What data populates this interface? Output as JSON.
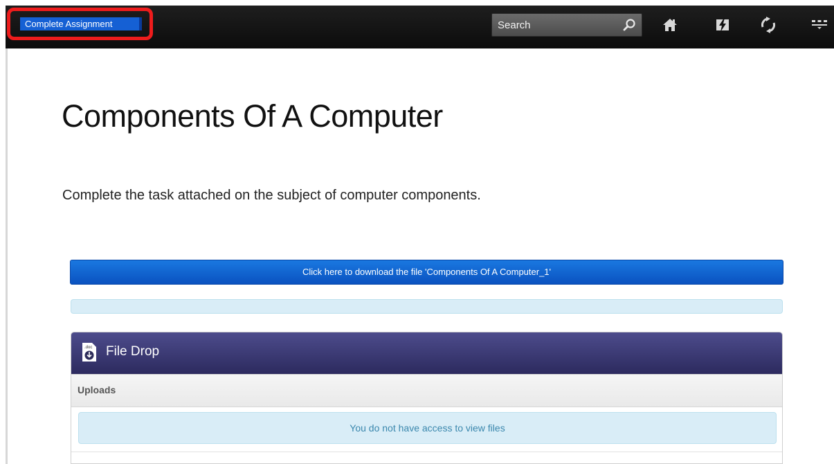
{
  "topbar": {
    "complete_label": "Complete Assignment",
    "search_placeholder": "Search",
    "icons": [
      "search-icon",
      "home-icon",
      "flash-icon",
      "sync-icon",
      "menu-icon"
    ]
  },
  "page": {
    "title": "Components Of A Computer",
    "description": "Complete the task attached on the subject of computer components."
  },
  "download": {
    "label": "Click here to download the file 'Components Of A Computer_1'"
  },
  "file_drop": {
    "title": "File Drop",
    "icon_text": ".doc",
    "uploads_label": "Uploads",
    "no_access_message": "You do not have access to view files"
  },
  "colors": {
    "topbar": "#151515",
    "highlight": "#ee1c1c",
    "complete_button": "#1560d4",
    "download_button": "#0a5fd0",
    "panel_header": "#3c3a74",
    "info": "#d9edf7",
    "info_text": "#3a87ad"
  }
}
